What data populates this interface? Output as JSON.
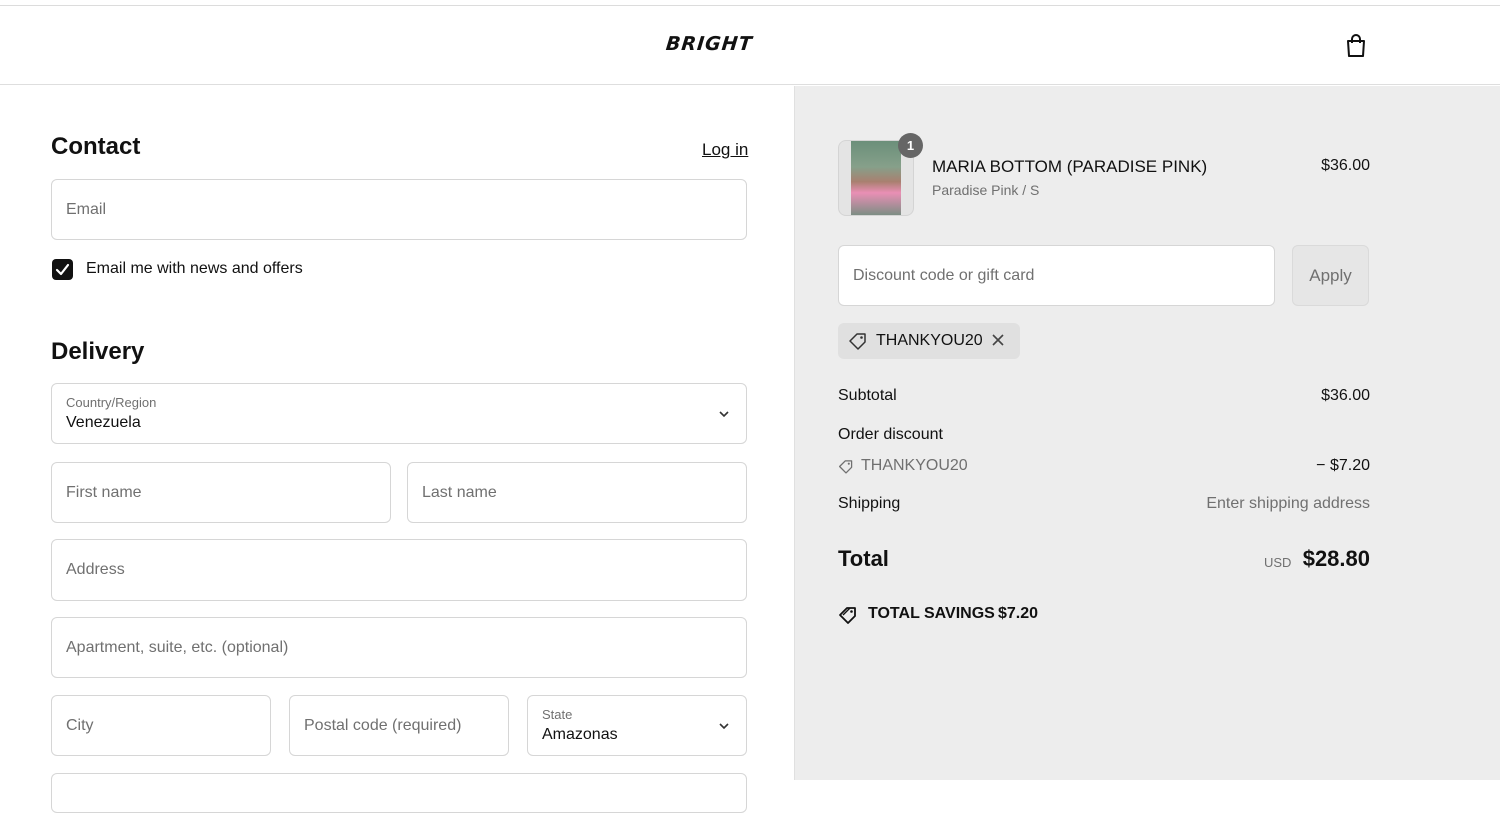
{
  "header": {
    "logo_text": "BRIGHT",
    "cart_icon": "shopping-bag-icon"
  },
  "contact": {
    "heading": "Contact",
    "login_link": "Log in",
    "email_placeholder": "Email",
    "newsletter_checked": true,
    "newsletter_label": "Email me with news and offers"
  },
  "delivery": {
    "heading": "Delivery",
    "country_label": "Country/Region",
    "country_value": "Venezuela",
    "first_name_placeholder": "First name",
    "last_name_placeholder": "Last name",
    "address_placeholder": "Address",
    "apartment_placeholder": "Apartment, suite, etc. (optional)",
    "city_placeholder": "City",
    "postal_placeholder": "Postal code (required)",
    "state_label": "State",
    "state_value": "Amazonas"
  },
  "order": {
    "item": {
      "quantity": "1",
      "name": "MARIA BOTTOM (PARADISE PINK)",
      "variant": "Paradise Pink / S",
      "price": "$36.00"
    },
    "discount_placeholder": "Discount code or gift card",
    "apply_label": "Apply",
    "applied_code": "THANKYOU20",
    "subtotal_label": "Subtotal",
    "subtotal_value": "$36.00",
    "order_discount_label": "Order discount",
    "discount_code": "THANKYOU20",
    "discount_value": "− $7.20",
    "shipping_label": "Shipping",
    "shipping_value": "Enter shipping address",
    "total_label": "Total",
    "total_currency": "USD",
    "total_value": "$28.80",
    "savings_label": "TOTAL SAVINGS",
    "savings_value": "$7.20"
  },
  "colors": {
    "summary_bg": "#ededed",
    "checkbox": "#111111",
    "muted_text": "#707070"
  }
}
